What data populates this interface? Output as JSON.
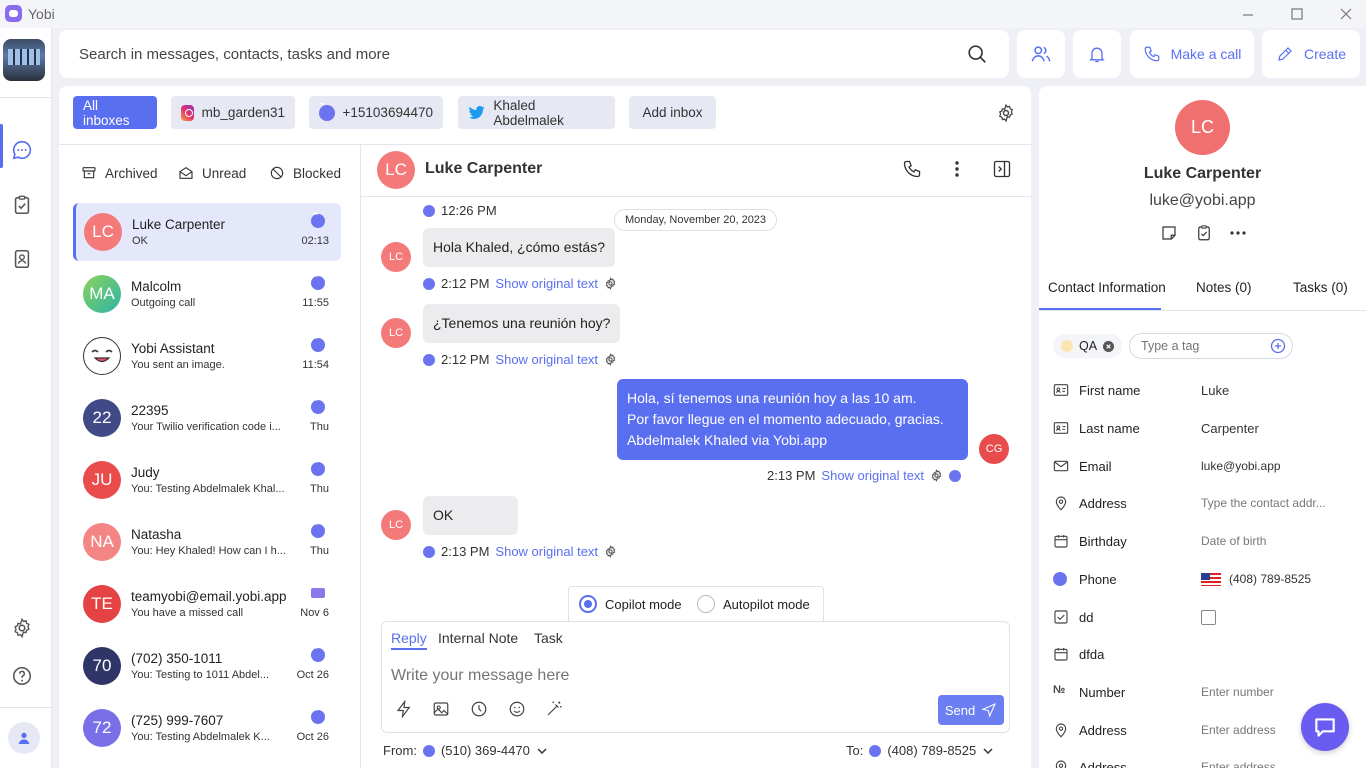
{
  "app": {
    "name": "Yobi"
  },
  "search": {
    "placeholder": "Search in messages, contacts, tasks and more"
  },
  "topbar": {
    "make_call": "Make a call",
    "create": "Create"
  },
  "inboxes": [
    {
      "label": "All inboxes",
      "icon": "none",
      "active": true
    },
    {
      "label": "mb_garden31",
      "icon": "instagram-icon"
    },
    {
      "label": "+15103694470",
      "icon": "chat-bubble-icon"
    },
    {
      "label": "Khaled Abdelmalek",
      "icon": "twitter-icon"
    },
    {
      "label": "Add inbox",
      "icon": "none"
    }
  ],
  "filters": {
    "archived": "Archived",
    "unread": "Unread",
    "blocked": "Blocked"
  },
  "conversations": [
    {
      "initials": "LC",
      "name": "Luke Carpenter",
      "preview": "OK",
      "time": "02:13",
      "color": "#f06b6b",
      "active": true
    },
    {
      "initials": "MA",
      "name": "Malcolm",
      "preview": "Outgoing call",
      "time": "11:55",
      "color": "#5cc36a"
    },
    {
      "initials": "",
      "name": "Yobi Assistant",
      "preview": "You sent an image.",
      "time": "11:54",
      "color": "#ffffff"
    },
    {
      "initials": "22",
      "name": "22395",
      "preview": "Your Twilio verification code i...",
      "time": "Thu",
      "color": "#3f4a86"
    },
    {
      "initials": "JU",
      "name": "Judy",
      "preview": "You: Testing Abdelmalek Khal...",
      "time": "Thu",
      "color": "#ea4b4b"
    },
    {
      "initials": "NA",
      "name": "Natasha",
      "preview": "You: Hey Khaled! How can I h...",
      "time": "Thu",
      "color": "#f48585"
    },
    {
      "initials": "TE",
      "name": "teamyobi@email.yobi.app",
      "preview": "You have a missed call",
      "time": "Nov 6",
      "color": "#e54343"
    },
    {
      "initials": "70",
      "name": "(702) 350-1011",
      "preview": "You: Testing to 1011 Abdel...",
      "time": "Oct 26",
      "color": "#2f3566"
    },
    {
      "initials": "72",
      "name": "(725) 999-7607",
      "preview": "You: Testing Abdelmalek K...",
      "time": "Oct 26",
      "color": "#7a6fe8"
    }
  ],
  "chat": {
    "contact_initials": "LC",
    "contact_name": "Luke Carpenter",
    "date_divider": "Monday, November 20, 2023",
    "first_time": "12:26 PM",
    "show_original": "Show original text",
    "messages": [
      {
        "text": "Hola Khaled, ¿cómo estás?",
        "time": "2:12 PM"
      },
      {
        "text": "¿Tenemos una reunión hoy?",
        "time": "2:12 PM"
      },
      {
        "line1": "Hola, sí tenemos una reunión hoy a las 10 am.",
        "line2": "Por favor llegue en el momento adecuado, gracias.",
        "line3": "Abdelmalek Khaled via Yobi.app",
        "time": "2:13 PM",
        "initials": "CG"
      },
      {
        "text": "OK",
        "time": "2:13 PM"
      }
    ]
  },
  "composer": {
    "copilot": "Copilot mode",
    "autopilot": "Autopilot mode",
    "tabs": {
      "reply": "Reply",
      "note": "Internal Note",
      "task": "Task"
    },
    "placeholder": "Write your message here",
    "send": "Send",
    "from_label": "From:",
    "from_number": "(510) 369-4470",
    "to_label": "To:",
    "to_number": "(408) 789-8525"
  },
  "contact": {
    "initials": "LC",
    "name": "Luke Carpenter",
    "email": "luke@yobi.app",
    "tabs": {
      "info": "Contact Information",
      "notes": "Notes (0)",
      "tasks": "Tasks (0)"
    },
    "tag": "QA",
    "tag_placeholder": "Type a tag",
    "fields": [
      {
        "label": "First name",
        "value": "Luke",
        "icon": "id-card-icon"
      },
      {
        "label": "Last name",
        "value": "Carpenter",
        "icon": "id-card-icon"
      },
      {
        "label": "Email",
        "value": "luke@yobi.app",
        "icon": "mail-icon"
      },
      {
        "label": "Address",
        "value": "Type the contact addr...",
        "icon": "location-pin-icon",
        "placeholder": true
      },
      {
        "label": "Birthday",
        "value": "Date of birth",
        "icon": "calendar-icon",
        "placeholder": true
      },
      {
        "label": "Phone",
        "value": "(408) 789-8525",
        "icon": "chat-bubble-icon"
      },
      {
        "label": "dd",
        "value": "",
        "icon": "checkbox-icon"
      },
      {
        "label": "dfda",
        "value": "",
        "icon": "calendar-icon"
      },
      {
        "label": "Number",
        "value": "Enter number",
        "icon": "number-icon",
        "placeholder": true
      },
      {
        "label": "Address",
        "value": "Enter address",
        "icon": "location-pin-icon",
        "placeholder": true
      },
      {
        "label": "Address",
        "value": "Enter address",
        "icon": "location-pin-icon",
        "placeholder": true
      }
    ]
  },
  "colors": {
    "accent": "#5a6ff0",
    "contact_avatar": "#f07070"
  }
}
